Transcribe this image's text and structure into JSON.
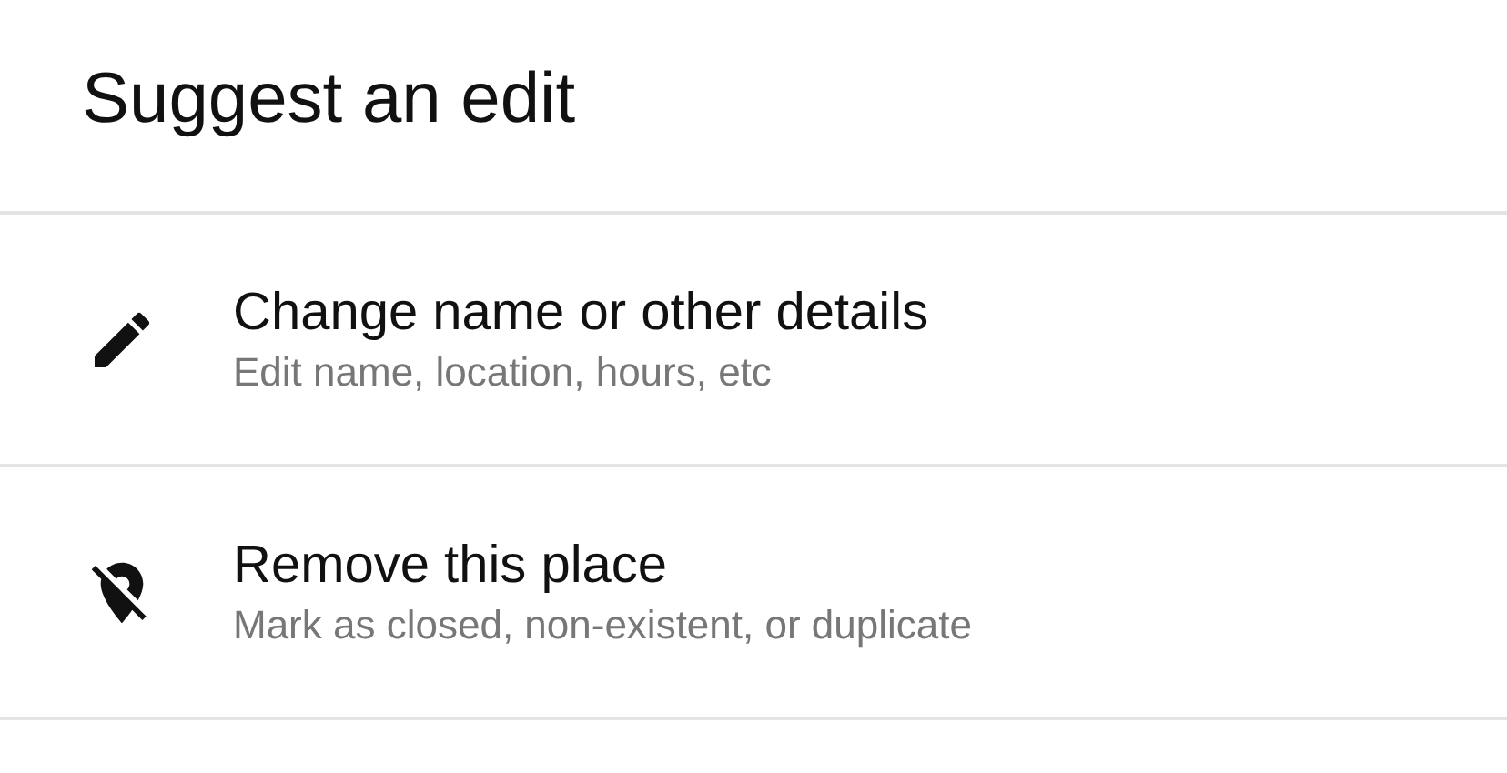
{
  "title": "Suggest an edit",
  "options": [
    {
      "kind": "edit",
      "label": "Change name or other details",
      "description": "Edit name, location, hours, etc"
    },
    {
      "kind": "remove",
      "label": "Remove this place",
      "description": "Mark as closed, non-existent, or duplicate"
    }
  ]
}
